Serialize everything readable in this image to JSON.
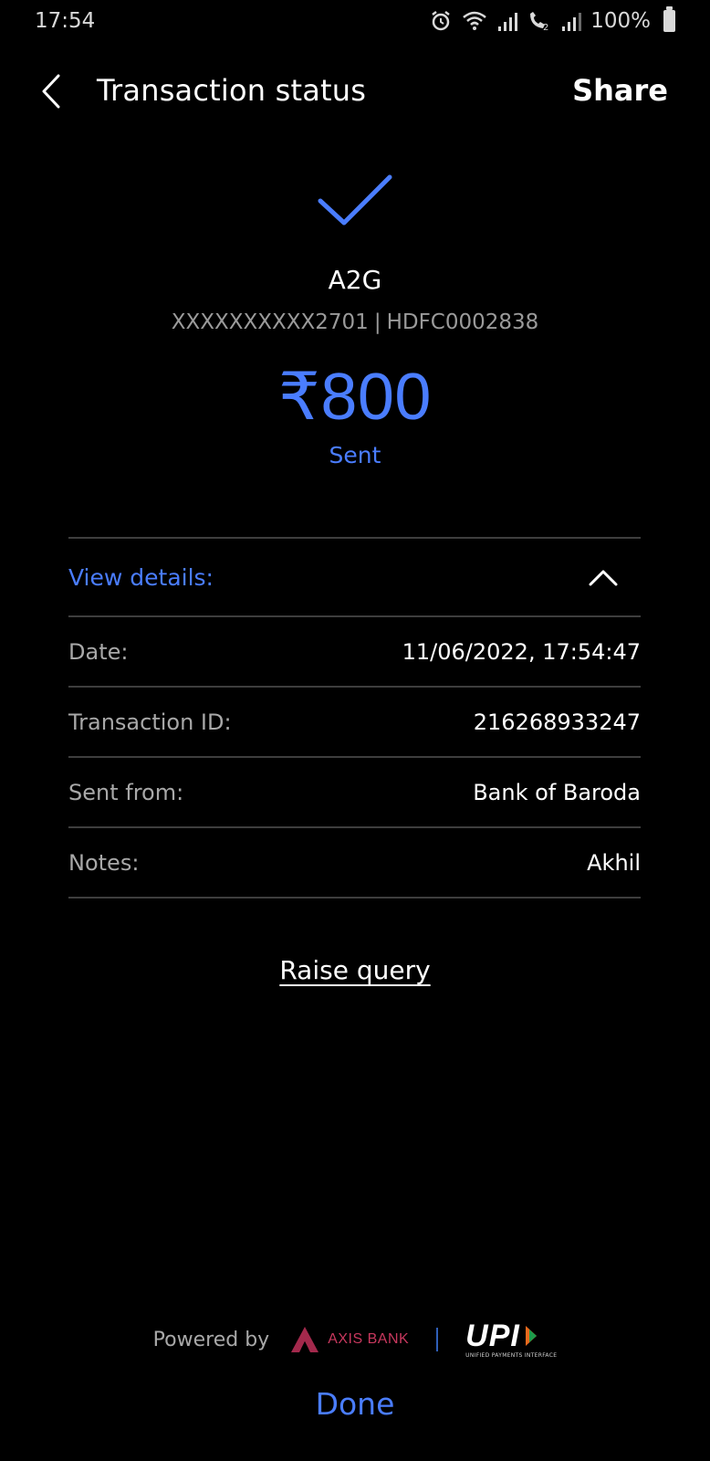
{
  "status_bar": {
    "time": "17:54",
    "battery": "100%",
    "icons": [
      "alarm-icon",
      "wifi-icon",
      "signal-icon",
      "wifi-calling-icon",
      "signal-icon",
      "battery-icon"
    ]
  },
  "header": {
    "title": "Transaction status",
    "share_label": "Share"
  },
  "transaction": {
    "payee_name": "A2G",
    "account": "XXXXXXXXXX2701",
    "ifsc": "HDFC0002838",
    "amount": "₹800",
    "status": "Sent"
  },
  "details": {
    "toggle_label": "View details:",
    "rows": [
      {
        "label": "Date:",
        "value": "11/06/2022, 17:54:47"
      },
      {
        "label": "Transaction ID:",
        "value": "216268933247"
      },
      {
        "label": "Sent from:",
        "value": "Bank of Baroda"
      },
      {
        "label": "Notes:",
        "value": "Akhil"
      }
    ]
  },
  "actions": {
    "raise_query": "Raise query",
    "done": "Done"
  },
  "footer": {
    "powered_by": "Powered by",
    "bank": "AXIS BANK",
    "upi": "UPI",
    "upi_sub": "UNIFIED PAYMENTS INTERFACE"
  },
  "colors": {
    "accent": "#4a7dff",
    "background": "#000000",
    "divider": "#3e3e3e",
    "axis": "#c8385e"
  }
}
